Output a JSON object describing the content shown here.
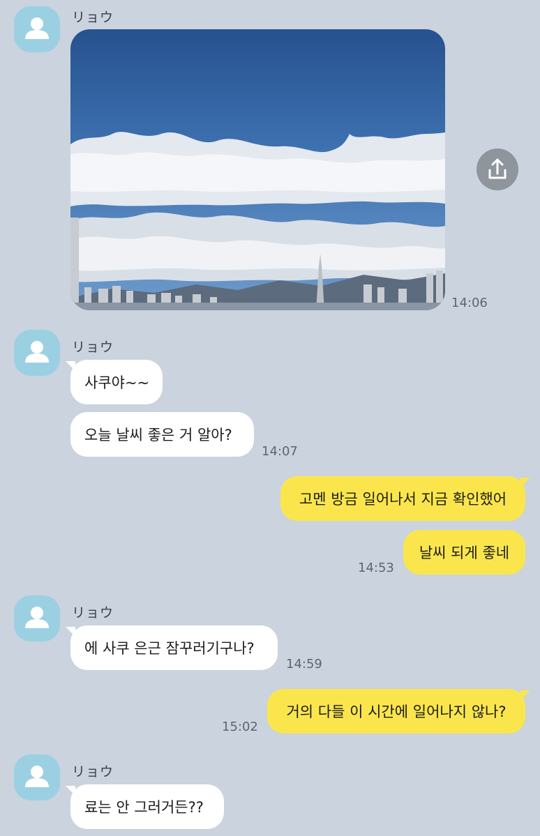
{
  "chat": {
    "groups": [
      {
        "sender": "リョウ",
        "type": "photo",
        "time": "14:06"
      },
      {
        "sender": "リョウ",
        "messages": [
          "사쿠야~~",
          "오늘 날씨 좋은 거 알아?"
        ],
        "time": "14:07"
      },
      {
        "outgoing": [
          "고멘 방금 일어나서 지금 확인했어",
          "날씨 되게 좋네"
        ],
        "time": "14:53"
      },
      {
        "sender": "リョウ",
        "messages": [
          "에 사쿠 은근 잠꾸러기구나?"
        ],
        "time": "14:59"
      },
      {
        "outgoing": [
          "거의 다들 이 시간에 일어나지 않나?"
        ],
        "time": "15:02"
      },
      {
        "sender": "リョウ",
        "messages": [
          "료는 안 그러거든??"
        ]
      }
    ]
  },
  "icons": {
    "avatar": "default-person-icon",
    "share": "share-upload-icon"
  },
  "colors": {
    "background": "#cad3de",
    "incoming_bubble": "#ffffff",
    "outgoing_bubble": "#fae64c",
    "avatar": "#9bd0e3"
  }
}
